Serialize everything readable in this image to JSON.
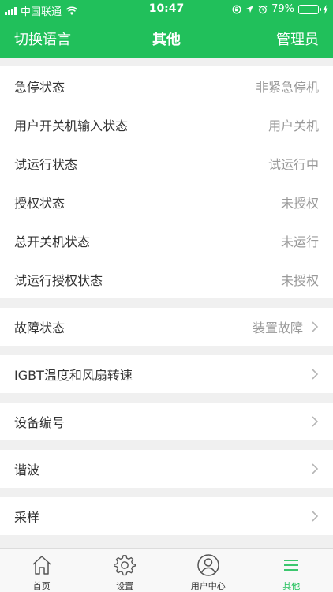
{
  "statusbar": {
    "carrier": "中国联通",
    "time": "10:47",
    "battery": "79%",
    "battery_level": 0.79,
    "signal_icon": "signal-bars-icon",
    "wifi_icon": "wifi-icon"
  },
  "navbar": {
    "left": "切换语言",
    "title": "其他",
    "right": "管理员"
  },
  "status_rows": [
    {
      "label": "急停状态",
      "value": "非紧急停机"
    },
    {
      "label": "用户开关机输入状态",
      "value": "用户关机"
    },
    {
      "label": "试运行状态",
      "value": "试运行中"
    },
    {
      "label": "授权状态",
      "value": "未授权"
    },
    {
      "label": "总开关机状态",
      "value": "未运行"
    },
    {
      "label": "试运行授权状态",
      "value": "未授权"
    }
  ],
  "fault": {
    "label": "故障状态",
    "value": "装置故障"
  },
  "menu_rows": [
    {
      "label": "IGBT温度和风扇转速"
    },
    {
      "label": "设备编号"
    },
    {
      "label": "谐波"
    },
    {
      "label": "采样"
    }
  ],
  "tabs": [
    {
      "label": "首页",
      "icon": "home-icon"
    },
    {
      "label": "设置",
      "icon": "gear-icon"
    },
    {
      "label": "用户中心",
      "icon": "user-icon"
    },
    {
      "label": "其他",
      "icon": "menu-icon"
    }
  ],
  "colors": {
    "accent": "#21c05b",
    "value_text": "#999999",
    "background": "#f0f0f0"
  }
}
